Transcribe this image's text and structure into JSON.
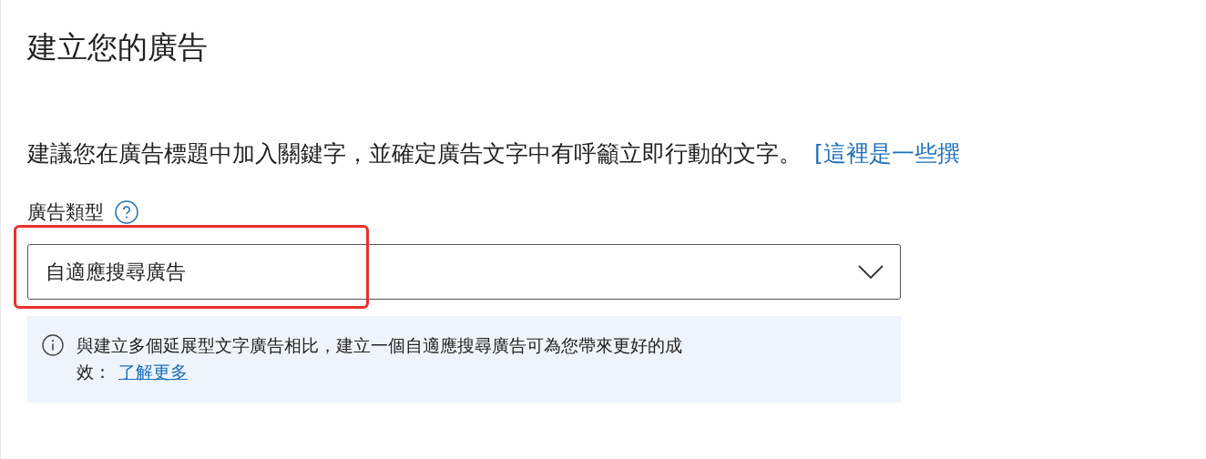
{
  "title": "建立您的廣告",
  "hint": {
    "text": "建議您在廣告標題中加入關鍵字，並確定廣告文字中有呼籲立即行動的文字。",
    "link": "[這裡是一些撰"
  },
  "ad_type": {
    "label": "廣告類型",
    "value": "自適應搜尋廣告",
    "highlighted": true
  },
  "info": {
    "text": "與建立多個延展型文字廣告相比，建立一個自適應搜尋廣告可為您帶來更好的成效：",
    "link": "了解更多"
  }
}
